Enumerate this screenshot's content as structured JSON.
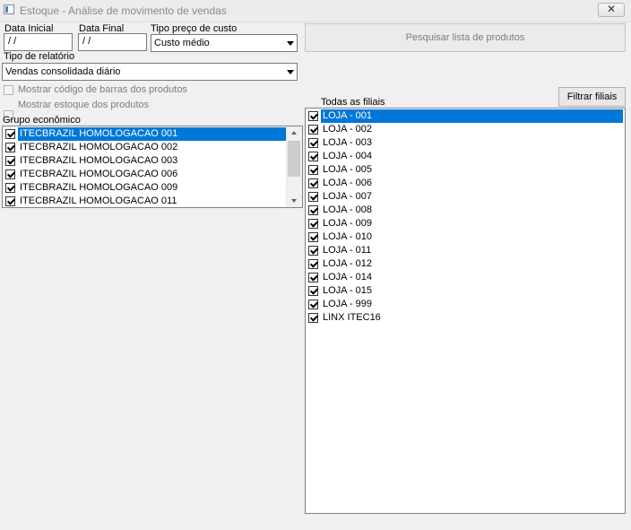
{
  "window": {
    "title": "Estoque - Análise de movimento de vendas",
    "close_label": "✕"
  },
  "filters": {
    "data_inicial": {
      "label": "Data Inicial",
      "value": " /  /"
    },
    "data_final": {
      "label": "Data Final",
      "value": " /  /"
    },
    "tipo_preco_custo": {
      "label": "Tipo preço de custo",
      "value": "Custo médio"
    },
    "pesquisar_button": "Pesquisar lista de produtos",
    "tipo_relatorio": {
      "label": "Tipo de relatório",
      "value": "Vendas consolidada diário"
    },
    "mostrar_codigo_barras": {
      "label": "Mostrar código de barras dos produtos",
      "checked": false,
      "enabled": false
    },
    "mostrar_estoque": {
      "label": "Mostrar estoque dos produtos",
      "checked": false,
      "enabled": false
    }
  },
  "grupo_economico": {
    "label": "Grupo econômico",
    "items": [
      {
        "label": "ITECBRAZIL HOMOLOGACAO 001",
        "checked": true,
        "selected": true
      },
      {
        "label": "ITECBRAZIL HOMOLOGACAO 002",
        "checked": true,
        "selected": false
      },
      {
        "label": "ITECBRAZIL HOMOLOGACAO 003",
        "checked": true,
        "selected": false
      },
      {
        "label": "ITECBRAZIL HOMOLOGACAO 006",
        "checked": true,
        "selected": false
      },
      {
        "label": "ITECBRAZIL HOMOLOGACAO 009",
        "checked": true,
        "selected": false
      },
      {
        "label": "ITECBRAZIL HOMOLOGACAO 011",
        "checked": true,
        "selected": false
      }
    ]
  },
  "filiais": {
    "todas_label": "Todas as filiais",
    "todas_checked": true,
    "filtrar_button": "Filtrar filiais",
    "items": [
      {
        "label": "LOJA - 001",
        "checked": true,
        "selected": true
      },
      {
        "label": "LOJA - 002",
        "checked": true,
        "selected": false
      },
      {
        "label": "LOJA - 003",
        "checked": true,
        "selected": false
      },
      {
        "label": "LOJA - 004",
        "checked": true,
        "selected": false
      },
      {
        "label": "LOJA - 005",
        "checked": true,
        "selected": false
      },
      {
        "label": "LOJA - 006",
        "checked": true,
        "selected": false
      },
      {
        "label": "LOJA - 007",
        "checked": true,
        "selected": false
      },
      {
        "label": "LOJA - 008",
        "checked": true,
        "selected": false
      },
      {
        "label": "LOJA - 009",
        "checked": true,
        "selected": false
      },
      {
        "label": "LOJA - 010",
        "checked": true,
        "selected": false
      },
      {
        "label": "LOJA - 011",
        "checked": true,
        "selected": false
      },
      {
        "label": "LOJA - 012",
        "checked": true,
        "selected": false
      },
      {
        "label": "LOJA - 014",
        "checked": true,
        "selected": false
      },
      {
        "label": "LOJA - 015",
        "checked": true,
        "selected": false
      },
      {
        "label": "LOJA - 999",
        "checked": true,
        "selected": false
      },
      {
        "label": "LINX ITEC16",
        "checked": true,
        "selected": false
      }
    ]
  },
  "colors": {
    "selection": "#0078d7",
    "background": "#f0f0f0"
  }
}
